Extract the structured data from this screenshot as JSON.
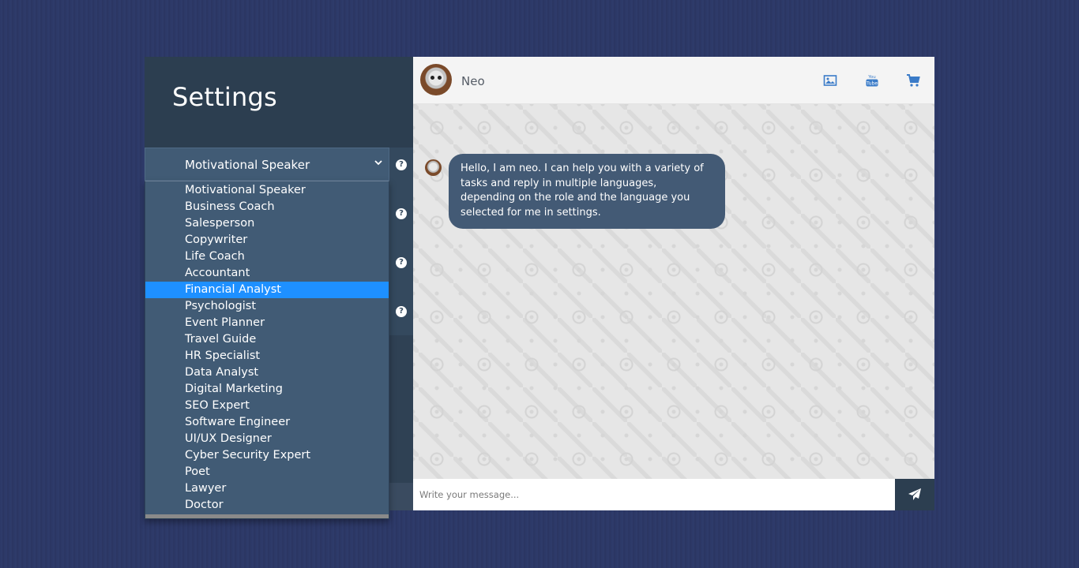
{
  "sidebar": {
    "title": "Settings",
    "role_select": {
      "value": "Motivational Speaker",
      "options": [
        "Motivational Speaker",
        "Business Coach",
        "Salesperson",
        "Copywriter",
        "Life Coach",
        "Accountant",
        "Financial Analyst",
        "Psychologist",
        "Event Planner",
        "Travel Guide",
        "HR Specialist",
        "Data Analyst",
        "Digital Marketing",
        "SEO Expert",
        "Software Engineer",
        "UI/UX Designer",
        "Cyber Security Expert",
        "Poet",
        "Lawyer",
        "Doctor"
      ],
      "highlighted": "Financial Analyst"
    },
    "help_icon": "question-circle-icon",
    "help_glyph": "?"
  },
  "chat": {
    "contact_name": "Neo",
    "header_buttons": [
      "image-icon",
      "youtube-icon",
      "cart-icon"
    ],
    "messages": [
      {
        "sender": "bot",
        "text": "Hello, I am neo. I can help you with a variety of tasks and reply in multiple languages, depending on the role and the language you selected for me in settings."
      }
    ],
    "input": {
      "placeholder": "Write your message...",
      "value": ""
    },
    "send_icon": "paper-plane-icon"
  },
  "colors": {
    "background": "#2c3866",
    "sidebar_dark": "#2c3e50",
    "dropdown": "#415b75",
    "highlight": "#1e90ff",
    "bubble": "#435a75",
    "accent_icons": "#3a7bc8"
  }
}
